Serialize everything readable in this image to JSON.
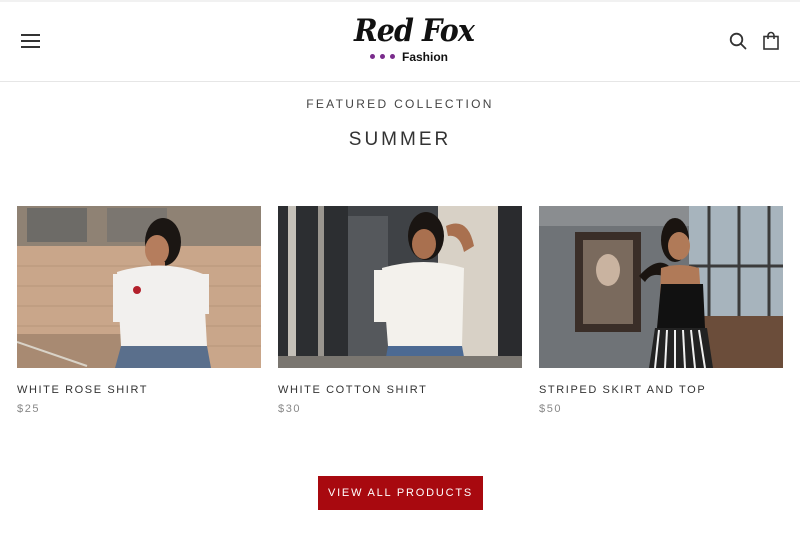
{
  "header": {
    "logo": {
      "script_text": "Red Fox",
      "sub_text": "Fashion"
    },
    "icons": [
      "hamburger-menu-icon",
      "search-icon",
      "shopping-bag-icon"
    ]
  },
  "section": {
    "eyebrow": "FEATURED COLLECTION",
    "title": "SUMMER"
  },
  "products": [
    {
      "name": "WHITE ROSE SHIRT",
      "price": "$25"
    },
    {
      "name": "WHITE COTTON SHIRT",
      "price": "$30"
    },
    {
      "name": "STRIPED SKIRT AND TOP",
      "price": "$50"
    }
  ],
  "cta": {
    "label": "VIEW ALL PRODUCTS"
  },
  "colors": {
    "accent": "#a8090f",
    "logo_dots": "#7a2c8c"
  }
}
